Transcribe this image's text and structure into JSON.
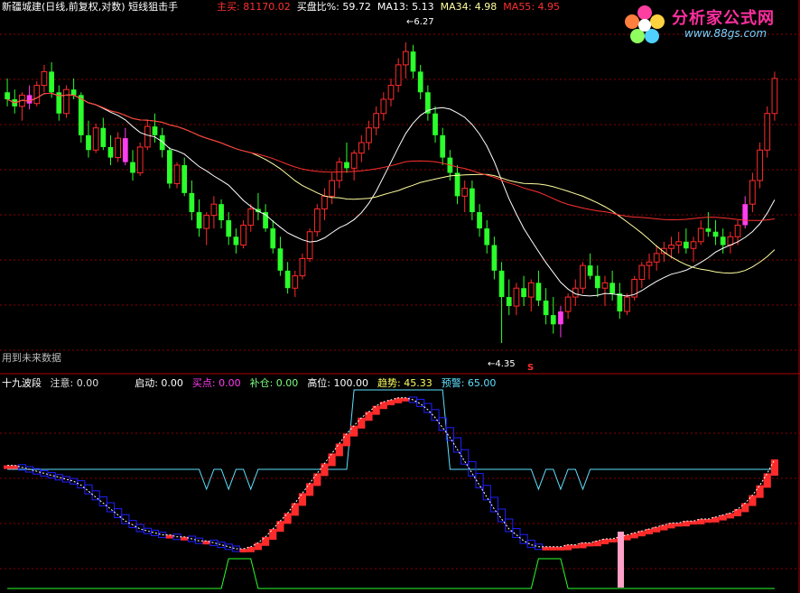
{
  "header_top": {
    "stock": "新疆城建(日线,前复权,对数)",
    "indicator": "短线狙击手",
    "main_buy_label": "主买",
    "main_buy_value": "81170.02",
    "buy_ratio_label": "买盘比%",
    "buy_ratio_value": "59.72",
    "ma13_label": "MA13",
    "ma13_value": "5.13",
    "ma34_label": "MA34",
    "ma34_value": "4.98",
    "ma55_label": "MA55",
    "ma55_value": "4.95"
  },
  "header_bottom": {
    "title": "十九波段",
    "items": [
      {
        "label": "注意",
        "value": "0.00",
        "color": "#e0e0e0"
      },
      {
        "label": "启动",
        "value": "0.00",
        "color": "#ffffff"
      },
      {
        "label": "买点",
        "value": "0.00",
        "color": "#ff3df0"
      },
      {
        "label": "补仓",
        "value": "0.00",
        "color": "#7dff7d"
      },
      {
        "label": "高位",
        "value": "100.00",
        "color": "#ffffff"
      },
      {
        "label": "趋势",
        "value": "45.33",
        "color": "#ffff60"
      },
      {
        "label": "预警",
        "value": "65.00",
        "color": "#5fe0ff"
      }
    ]
  },
  "annotations": {
    "high_label": "6.27",
    "low_label": "4.35",
    "s_mark": "S",
    "future_data_note": "用到未来数据"
  },
  "logo": {
    "title": "分析家公式网",
    "url": "www.88gs.com",
    "flower_colors": [
      "#ff3fa0",
      "#ffd23f",
      "#4fd0ff",
      "#8fff5f",
      "#ff7f3f"
    ]
  },
  "colors": {
    "background": "#000000",
    "up": "#ff2b2b",
    "down": "#2bff2b",
    "purple": "#ff3df0",
    "ma13": "#ffffff",
    "ma34": "#ffff9f",
    "ma55": "#ff3030",
    "grid": "#8b0000",
    "band_blue": "#2020ff",
    "cyan": "#5fe0ff",
    "green_line": "#2bff2b"
  },
  "chart_data": {
    "type": "candlestick",
    "price_scale": "log",
    "ylim": [
      4.2,
      6.5
    ],
    "candles": [
      [
        5.9,
        6.0,
        5.8,
        5.85
      ],
      [
        5.85,
        5.92,
        5.75,
        5.8
      ],
      [
        5.8,
        5.9,
        5.7,
        5.88
      ],
      [
        5.88,
        5.95,
        5.78,
        5.82
      ],
      [
        5.82,
        5.98,
        5.8,
        5.95
      ],
      [
        5.95,
        6.1,
        5.9,
        6.05
      ],
      [
        6.05,
        6.12,
        5.86,
        5.9
      ],
      [
        5.9,
        5.95,
        5.7,
        5.75
      ],
      [
        5.75,
        5.95,
        5.72,
        5.92
      ],
      [
        5.92,
        6.0,
        5.85,
        5.88
      ],
      [
        5.88,
        5.9,
        5.55,
        5.6
      ],
      [
        5.6,
        5.7,
        5.45,
        5.5
      ],
      [
        5.5,
        5.68,
        5.48,
        5.65
      ],
      [
        5.65,
        5.72,
        5.5,
        5.52
      ],
      [
        5.52,
        5.6,
        5.4,
        5.45
      ],
      [
        5.45,
        5.62,
        5.42,
        5.58
      ],
      [
        5.58,
        5.65,
        5.4,
        5.42
      ],
      [
        5.42,
        5.5,
        5.3,
        5.35
      ],
      [
        5.35,
        5.55,
        5.33,
        5.52
      ],
      [
        5.52,
        5.7,
        5.5,
        5.66
      ],
      [
        5.66,
        5.75,
        5.55,
        5.6
      ],
      [
        5.6,
        5.65,
        5.45,
        5.5
      ],
      [
        5.5,
        5.52,
        5.25,
        5.28
      ],
      [
        5.28,
        5.42,
        5.25,
        5.4
      ],
      [
        5.4,
        5.45,
        5.2,
        5.22
      ],
      [
        5.22,
        5.3,
        5.05,
        5.1
      ],
      [
        5.1,
        5.18,
        4.95,
        5.0
      ],
      [
        5.0,
        5.1,
        4.9,
        5.08
      ],
      [
        5.08,
        5.2,
        5.0,
        5.15
      ],
      [
        5.15,
        5.18,
        5.0,
        5.05
      ],
      [
        5.05,
        5.1,
        4.9,
        4.95
      ],
      [
        4.95,
        5.0,
        4.85,
        4.9
      ],
      [
        4.9,
        5.05,
        4.88,
        5.02
      ],
      [
        5.02,
        5.15,
        4.98,
        5.12
      ],
      [
        5.12,
        5.22,
        5.05,
        5.1
      ],
      [
        5.1,
        5.15,
        4.98,
        5.0
      ],
      [
        5.0,
        5.05,
        4.85,
        4.88
      ],
      [
        4.88,
        4.95,
        4.72,
        4.75
      ],
      [
        4.75,
        4.8,
        4.62,
        4.65
      ],
      [
        4.65,
        4.75,
        4.6,
        4.72
      ],
      [
        4.72,
        4.85,
        4.7,
        4.82
      ],
      [
        4.82,
        5.0,
        4.8,
        4.98
      ],
      [
        4.98,
        5.15,
        4.95,
        5.12
      ],
      [
        5.12,
        5.25,
        5.05,
        5.2
      ],
      [
        5.2,
        5.35,
        5.15,
        5.3
      ],
      [
        5.3,
        5.45,
        5.25,
        5.42
      ],
      [
        5.42,
        5.55,
        5.35,
        5.38
      ],
      [
        5.38,
        5.5,
        5.3,
        5.48
      ],
      [
        5.48,
        5.6,
        5.42,
        5.55
      ],
      [
        5.55,
        5.7,
        5.5,
        5.65
      ],
      [
        5.65,
        5.8,
        5.6,
        5.75
      ],
      [
        5.75,
        5.9,
        5.7,
        5.85
      ],
      [
        5.85,
        6.0,
        5.8,
        5.95
      ],
      [
        5.95,
        6.15,
        5.9,
        6.1
      ],
      [
        6.1,
        6.27,
        6.0,
        6.2
      ],
      [
        6.2,
        6.25,
        6.0,
        6.05
      ],
      [
        6.05,
        6.1,
        5.85,
        5.9
      ],
      [
        5.9,
        5.95,
        5.7,
        5.75
      ],
      [
        5.75,
        5.8,
        5.55,
        5.6
      ],
      [
        5.6,
        5.65,
        5.4,
        5.45
      ],
      [
        5.45,
        5.5,
        5.3,
        5.35
      ],
      [
        5.35,
        5.4,
        5.15,
        5.2
      ],
      [
        5.2,
        5.3,
        5.1,
        5.25
      ],
      [
        5.25,
        5.3,
        5.05,
        5.1
      ],
      [
        5.1,
        5.15,
        4.95,
        5.0
      ],
      [
        5.0,
        5.05,
        4.85,
        4.9
      ],
      [
        4.9,
        4.95,
        4.7,
        4.75
      ],
      [
        4.75,
        4.8,
        4.35,
        4.6
      ],
      [
        4.6,
        4.7,
        4.5,
        4.55
      ],
      [
        4.55,
        4.68,
        4.5,
        4.65
      ],
      [
        4.65,
        4.72,
        4.55,
        4.6
      ],
      [
        4.6,
        4.7,
        4.52,
        4.68
      ],
      [
        4.68,
        4.75,
        4.55,
        4.58
      ],
      [
        4.58,
        4.65,
        4.45,
        4.5
      ],
      [
        4.5,
        4.6,
        4.4,
        4.45
      ],
      [
        4.45,
        4.55,
        4.38,
        4.52
      ],
      [
        4.52,
        4.62,
        4.48,
        4.6
      ],
      [
        4.6,
        4.7,
        4.55,
        4.65
      ],
      [
        4.65,
        4.8,
        4.62,
        4.78
      ],
      [
        4.78,
        4.85,
        4.7,
        4.72
      ],
      [
        4.72,
        4.78,
        4.6,
        4.65
      ],
      [
        4.65,
        4.72,
        4.55,
        4.68
      ],
      [
        4.68,
        4.75,
        4.58,
        4.62
      ],
      [
        4.62,
        4.68,
        4.48,
        4.52
      ],
      [
        4.52,
        4.62,
        4.5,
        4.6
      ],
      [
        4.6,
        4.72,
        4.58,
        4.7
      ],
      [
        4.7,
        4.8,
        4.65,
        4.78
      ],
      [
        4.78,
        4.85,
        4.7,
        4.8
      ],
      [
        4.8,
        4.9,
        4.75,
        4.85
      ],
      [
        4.85,
        4.92,
        4.8,
        4.88
      ],
      [
        4.88,
        4.95,
        4.82,
        4.9
      ],
      [
        4.9,
        4.98,
        4.85,
        4.92
      ],
      [
        4.92,
        5.0,
        4.85,
        4.88
      ],
      [
        4.88,
        4.95,
        4.8,
        4.92
      ],
      [
        4.92,
        5.05,
        4.9,
        5.0
      ],
      [
        5.0,
        5.1,
        4.95,
        4.98
      ],
      [
        4.98,
        5.05,
        4.9,
        4.95
      ],
      [
        4.95,
        5.0,
        4.85,
        4.9
      ],
      [
        4.9,
        4.98,
        4.85,
        4.95
      ],
      [
        4.95,
        5.05,
        4.9,
        5.02
      ],
      [
        5.02,
        5.2,
        5.0,
        5.15
      ],
      [
        5.15,
        5.35,
        5.1,
        5.3
      ],
      [
        5.3,
        5.55,
        5.25,
        5.5
      ],
      [
        5.5,
        5.8,
        5.45,
        5.75
      ],
      [
        5.75,
        6.05,
        5.7,
        6.0
      ]
    ],
    "purple_candle_indices": [
      3,
      16,
      75,
      100
    ],
    "ma13_label": "MA13",
    "ma34_label": "MA34",
    "ma55_label": "MA55",
    "bottom_panel": {
      "title": "十九波段",
      "trend_line_y_values": [
        62,
        62,
        61,
        60,
        59,
        58,
        57,
        56,
        55,
        54,
        52,
        49,
        46,
        43,
        40,
        37,
        34,
        32,
        30,
        29,
        28,
        27,
        27,
        26,
        26,
        25,
        24,
        24,
        23,
        22,
        21,
        20,
        20,
        21,
        23,
        26,
        30,
        34,
        38,
        43,
        48,
        53,
        58,
        63,
        68,
        73,
        78,
        82,
        86,
        89,
        92,
        94,
        95,
        96,
        96,
        95,
        93,
        90,
        86,
        81,
        76,
        70,
        64,
        58,
        52,
        46,
        40,
        35,
        30,
        27,
        24,
        22,
        21,
        21,
        21,
        21,
        22,
        22,
        23,
        23,
        24,
        25,
        25,
        26,
        27,
        28,
        29,
        30,
        31,
        32,
        33,
        33,
        34,
        34,
        35,
        35,
        36,
        37,
        38,
        40,
        43,
        47,
        52,
        58,
        65
      ],
      "cyan_level": 60,
      "top_level": 100
    }
  }
}
